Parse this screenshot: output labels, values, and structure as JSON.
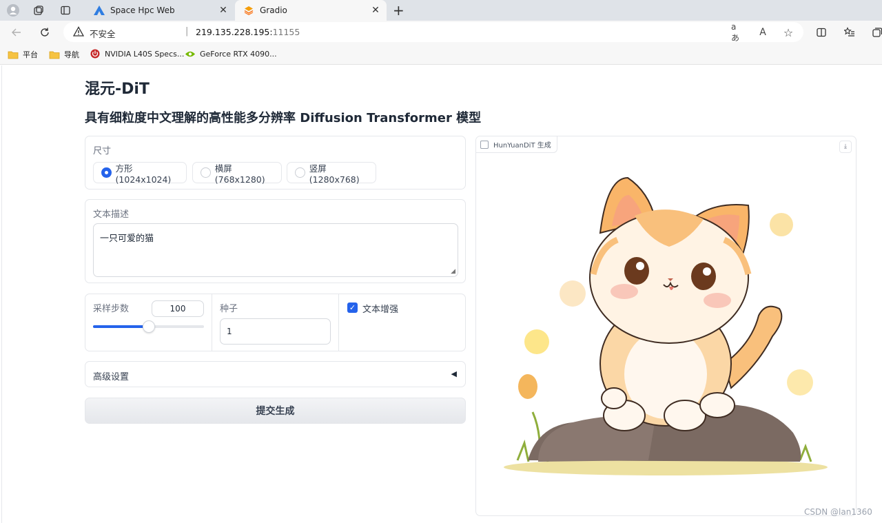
{
  "browser": {
    "tabs": [
      {
        "title": "Space Hpc Web"
      },
      {
        "title": "Gradio"
      }
    ],
    "address": {
      "security": "不安全",
      "separator": "|",
      "host": "219.135.228.195:",
      "port": "11155",
      "reader_icon": "aあ",
      "read_aloud_icon": "A"
    },
    "bookmarks": [
      {
        "label": "平台",
        "icon": "folder-icon"
      },
      {
        "label": "导航",
        "icon": "folder-icon"
      },
      {
        "label": "NVIDIA L40S Specs...",
        "icon": "power-icon"
      },
      {
        "label": "GeForce RTX 4090...",
        "icon": "nvidia-icon"
      }
    ]
  },
  "page": {
    "title": "混元-DiT",
    "subtitle": "具有细粒度中文理解的高性能多分辨率 Diffusion Transformer 模型",
    "size_section": {
      "label": "尺寸",
      "options": [
        {
          "label": "方形(1024x1024)",
          "selected": true
        },
        {
          "label": "横屏(768x1280)",
          "selected": false
        },
        {
          "label": "竖屏(1280x768)",
          "selected": false
        }
      ]
    },
    "prompt_section": {
      "label": "文本描述",
      "value": "一只可爱的猫"
    },
    "steps": {
      "label": "采样步数",
      "value": "100",
      "fraction": 0.5
    },
    "seed": {
      "label": "种子",
      "value": "1"
    },
    "enhance": {
      "label": "文本增强",
      "checked": true
    },
    "advanced": {
      "label": "高级设置",
      "toggle": "◀"
    },
    "submit_label": "提交生成",
    "output": {
      "label": "HunYuanDiT 生成"
    }
  },
  "watermark": "CSDN @lan1360",
  "colors": {
    "accent": "#2563eb",
    "tab_active": "#f7f7f7",
    "chrome": "#dfe3e8"
  }
}
